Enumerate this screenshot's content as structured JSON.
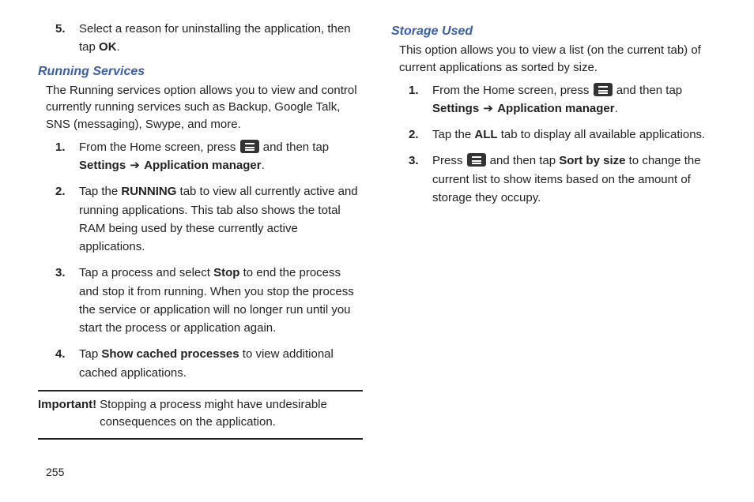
{
  "page_number": "255",
  "left": {
    "pre_item": {
      "num": "5.",
      "t1": "Select a reason for uninstalling the application, then tap ",
      "b1": "OK",
      "t2": "."
    },
    "heading": "Running Services",
    "intro": "The Running services option allows you to view and control currently running services such as Backup, Google Talk, SNS (messaging), Swype, and more.",
    "items": [
      {
        "num": "1.",
        "t1": "From the Home screen, press ",
        "icon": true,
        "t2": " and then tap ",
        "b1": "Settings",
        "arrow": " ➔ ",
        "b2": "Application manager",
        "t3": "."
      },
      {
        "num": "2.",
        "t1": "Tap the ",
        "b1": "RUNNING",
        "t2": " tab to view all currently active and running applications. This tab also shows the total RAM being used by these currently active applications."
      },
      {
        "num": "3.",
        "t1": "Tap a process and select ",
        "b1": "Stop",
        "t2": " to end the process and stop it from running. When you stop the process the service or application will no longer run until you start the process or application again."
      },
      {
        "num": "4.",
        "t1": "Tap ",
        "b1": "Show cached processes",
        "t2": " to view additional cached applications."
      }
    ],
    "important_label": "Important!",
    "important_text": " Stopping a process might have undesirable consequences on the application."
  },
  "right": {
    "heading": "Storage Used",
    "intro": "This option allows you to view a list (on the current tab) of current applications as sorted by size.",
    "items": [
      {
        "num": "1.",
        "t1": "From the Home screen, press ",
        "icon": true,
        "t2": " and then tap ",
        "b1": "Settings",
        "arrow": " ➔ ",
        "b2": "Application manager",
        "t3": "."
      },
      {
        "num": "2.",
        "t1": "Tap the ",
        "b1": "ALL",
        "t2": " tab to display all available applications."
      },
      {
        "num": "3.",
        "t1": "Press ",
        "icon": true,
        "t2": " and then tap ",
        "b1": "Sort by size",
        "t3": " to change the current list to show items based on the amount of storage they occupy."
      }
    ]
  }
}
